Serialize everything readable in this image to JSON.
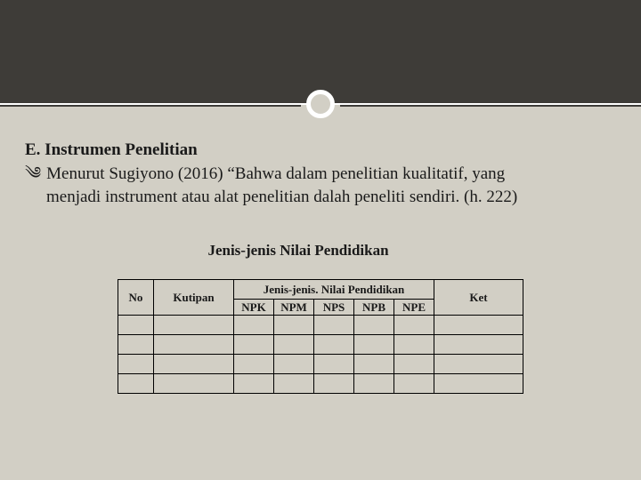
{
  "heading": "E. Instrumen Penelitian",
  "bullet_glyph": "༄",
  "bullet_line1": "Menurut Sugiyono (2016) “Bahwa dalam penelitian kualitatif, yang",
  "bullet_line2": "menjadi instrument atau alat penelitian dalah peneliti sendiri. (h. 222)",
  "subheading": "Jenis-jenis Nilai Pendidikan",
  "table": {
    "headers": {
      "no": "No",
      "kutipan": "Kutipan",
      "group": "Jenis-jenis. Nilai Pendidikan",
      "sub": [
        "NPK",
        "NPM",
        "NPS",
        "NPB",
        "NPE"
      ],
      "ket": "Ket"
    },
    "rows": [
      {
        "no": "",
        "kutipan": "",
        "sub": [
          "",
          "",
          "",
          "",
          ""
        ],
        "ket": ""
      },
      {
        "no": "",
        "kutipan": "",
        "sub": [
          "",
          "",
          "",
          "",
          ""
        ],
        "ket": ""
      },
      {
        "no": "",
        "kutipan": "",
        "sub": [
          "",
          "",
          "",
          "",
          ""
        ],
        "ket": ""
      },
      {
        "no": "",
        "kutipan": "",
        "sub": [
          "",
          "",
          "",
          "",
          ""
        ],
        "ket": ""
      }
    ]
  }
}
